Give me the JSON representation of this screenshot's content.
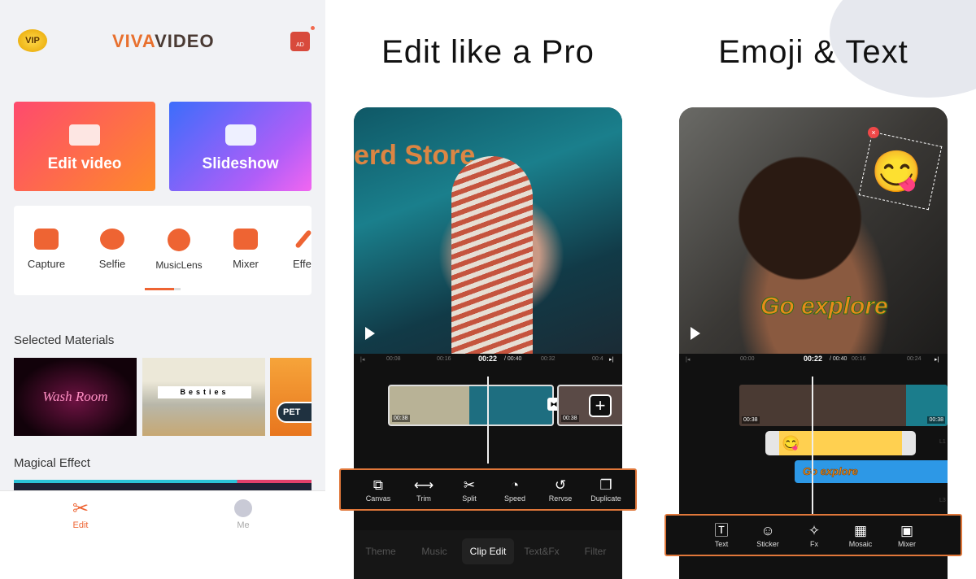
{
  "home": {
    "logo": "VIVAVIDEO",
    "vip_badge": "VIP",
    "ad_label": "AD",
    "cards": [
      {
        "label": "Edit video"
      },
      {
        "label": "Slideshow"
      }
    ],
    "tools": [
      {
        "label": "Capture",
        "icon": "camera-icon"
      },
      {
        "label": "Selfie",
        "icon": "selfie-icon"
      },
      {
        "label": "MusicLens",
        "icon": "musiclens-icon"
      },
      {
        "label": "Mixer",
        "icon": "mixer-icon"
      },
      {
        "label": "Effe",
        "icon": "magic-wand-icon"
      }
    ],
    "selected_materials": "Selected Materials",
    "materials": [
      {
        "text": "Wash Room"
      },
      {
        "text": "Besties"
      },
      {
        "text": "PET"
      }
    ],
    "magical_effect": "Magical Effect",
    "nav": [
      {
        "label": "Edit",
        "active": true,
        "icon": "scissors-icon"
      },
      {
        "label": "Me",
        "active": false,
        "icon": "user-icon"
      }
    ],
    "accent": "#ee6433"
  },
  "editor": {
    "title": "Edit like a Pro",
    "ruler": {
      "current": "00:22",
      "total": "/ 00:40",
      "ticks": [
        "00:08",
        "00:16",
        "00:32",
        "00:4"
      ]
    },
    "clip_durations": [
      "00:38",
      "00:38"
    ],
    "tools": [
      {
        "label": "Canvas",
        "glyph": "⧉"
      },
      {
        "label": "Trim",
        "glyph": "⟷"
      },
      {
        "label": "Split",
        "glyph": "✂"
      },
      {
        "label": "Speed",
        "glyph": "◔"
      },
      {
        "label": "Rervse",
        "glyph": "↺"
      },
      {
        "label": "Duplicate",
        "glyph": "❐"
      }
    ],
    "tabs": [
      "Theme",
      "Music",
      "Clip Edit",
      "Text&Fx",
      "Filter"
    ],
    "active_tab": "Clip Edit",
    "photo_text": "erd Store."
  },
  "emoji": {
    "title": "Emoji & Text",
    "ruler": {
      "current": "00:22",
      "total": "/ 00:40",
      "ticks": [
        "00:00",
        "00:16",
        "00:24"
      ]
    },
    "clip_durations": [
      "00:38",
      "00:38"
    ],
    "sticker": "😋",
    "overlay_text": "Go explore",
    "track_labels": [
      "L1",
      "L3"
    ],
    "tools": [
      {
        "label": "Text",
        "glyph": "🅃"
      },
      {
        "label": "Sticker",
        "glyph": "☺"
      },
      {
        "label": "Fx",
        "glyph": "✧"
      },
      {
        "label": "Mosaic",
        "glyph": "▦"
      },
      {
        "label": "Mixer",
        "glyph": "▣"
      }
    ],
    "bar_outline": "#e0773a"
  }
}
